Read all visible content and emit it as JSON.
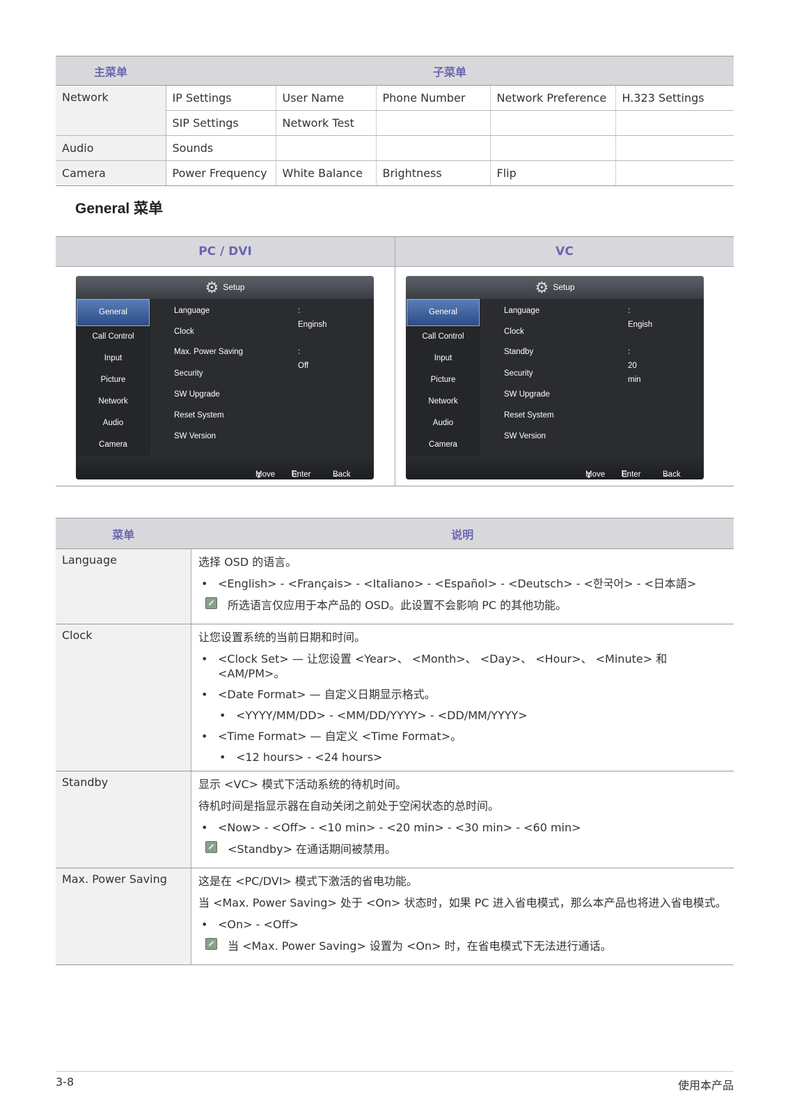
{
  "menu_table": {
    "headers": [
      "主菜单",
      "子菜单"
    ],
    "rows": [
      {
        "main": "Network",
        "subs": [
          [
            "IP Settings",
            "User Name",
            "Phone Number",
            "Network Preference",
            "H.323 Settings"
          ],
          [
            "SIP Settings",
            "Network Test",
            "",
            "",
            ""
          ]
        ]
      },
      {
        "main": "Audio",
        "subs": [
          [
            "Sounds",
            "",
            "",
            "",
            ""
          ]
        ]
      },
      {
        "main": "Camera",
        "subs": [
          [
            "Power Frequency",
            "White Balance",
            "Brightness",
            "Flip",
            ""
          ]
        ]
      }
    ]
  },
  "section_heading": "General 菜单",
  "screens": {
    "pc": {
      "header": "PC / DVI",
      "title": "Setup",
      "left_items": [
        "General",
        "Call Control",
        "Input",
        "Picture",
        "Network",
        "Audio",
        "Camera"
      ],
      "right_items": [
        "Language",
        "Clock",
        "Max. Power Saving",
        "Security",
        "SW Upgrade",
        "Reset System",
        "SW Version"
      ],
      "values": [
        ": Enginsh",
        "",
        ": Off",
        "",
        "",
        "",
        ""
      ],
      "footer": {
        "move": "Move",
        "enter": "Enter",
        "back": "Back"
      }
    },
    "vc": {
      "header": "VC",
      "title": "Setup",
      "left_items": [
        "General",
        "Call Control",
        "Input",
        "Picture",
        "Network",
        "Audio",
        "Camera"
      ],
      "right_items": [
        "Language",
        "Clock",
        "Standby",
        "Security",
        "SW Upgrade",
        "Reset System",
        "SW Version"
      ],
      "values": [
        ": Engish",
        "",
        ": 20 min",
        "",
        "",
        "",
        ""
      ],
      "footer": {
        "move": "Move",
        "enter": "Enter",
        "back": "Back"
      }
    }
  },
  "desc_table": {
    "headers": [
      "菜单",
      "说明"
    ],
    "language": {
      "menu": "Language",
      "intro": "选择 OSD 的语言。",
      "bullet": "<English> - <Français> - <Italiano> - <Español> - <Deutsch> - <한국어> - <日本語>",
      "note": "所选语言仅应用于本产品的 OSD。此设置不会影响 PC 的其他功能。"
    },
    "clock": {
      "menu": "Clock",
      "intro": "让您设置系统的当前日期和时间。",
      "b1": "<Clock Set> — 让您设置 <Year>、 <Month>、 <Day>、 <Hour>、 <Minute> 和 <AM/PM>。",
      "b2": "<Date Format> — 自定义日期显示格式。",
      "b2a": "<YYYY/MM/DD> - <MM/DD/YYYY> - <DD/MM/YYYY>",
      "b3": "<Time Format> — 自定义 <Time Format>。",
      "b3a": "<12 hours> - <24 hours>"
    },
    "standby": {
      "menu": "Standby",
      "p1": "显示 <VC> 模式下活动系统的待机时间。",
      "p2": "待机时间是指显示器在自动关闭之前处于空闲状态的总时间。",
      "bullet": "<Now> - <Off> - <10 min> - <20 min> - <30 min> - <60 min>",
      "note": "<Standby> 在通话期间被禁用。"
    },
    "max_power": {
      "menu": "Max. Power Saving",
      "p1": "这是在 <PC/DVI> 模式下激活的省电功能。",
      "p2": "当 <Max. Power Saving> 处于 <On> 状态时，如果 PC 进入省电模式，那么本产品也将进入省电模式。",
      "bullet": "<On> - <Off>",
      "note": "当 <Max. Power Saving> 设置为 <On> 时，在省电模式下无法进行通话。"
    }
  },
  "footer": {
    "page": "3-8",
    "title": "使用本产品"
  }
}
